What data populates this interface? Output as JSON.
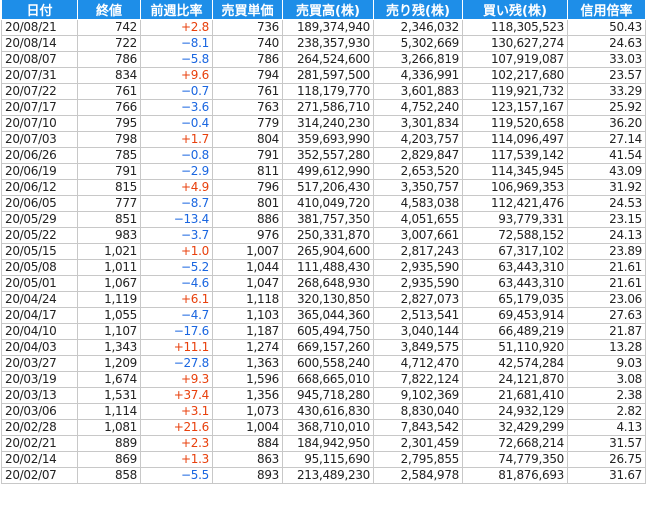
{
  "headers": [
    "日付",
    "終値",
    "前週比率",
    "売買単価",
    "売買高(株)",
    "売り残(株)",
    "買い残(株)",
    "信用倍率"
  ],
  "colors": {
    "header_bg": "#1e8ee8",
    "positive": "#e8400c",
    "negative": "#1a66e0"
  },
  "rows": [
    {
      "date": "20/08/21",
      "close": "742",
      "change": "+2.8",
      "dir": "up",
      "unit_price": "736",
      "volume": "189,374,940",
      "short": "2,346,032",
      "long": "118,305,523",
      "ratio": "50.43"
    },
    {
      "date": "20/08/14",
      "close": "722",
      "change": "−8.1",
      "dir": "down",
      "unit_price": "740",
      "volume": "238,357,930",
      "short": "5,302,669",
      "long": "130,627,274",
      "ratio": "24.63"
    },
    {
      "date": "20/08/07",
      "close": "786",
      "change": "−5.8",
      "dir": "down",
      "unit_price": "786",
      "volume": "264,524,600",
      "short": "3,266,819",
      "long": "107,919,087",
      "ratio": "33.03"
    },
    {
      "date": "20/07/31",
      "close": "834",
      "change": "+9.6",
      "dir": "up",
      "unit_price": "794",
      "volume": "281,597,500",
      "short": "4,336,991",
      "long": "102,217,680",
      "ratio": "23.57"
    },
    {
      "date": "20/07/22",
      "close": "761",
      "change": "−0.7",
      "dir": "down",
      "unit_price": "761",
      "volume": "118,179,770",
      "short": "3,601,883",
      "long": "119,921,732",
      "ratio": "33.29"
    },
    {
      "date": "20/07/17",
      "close": "766",
      "change": "−3.6",
      "dir": "down",
      "unit_price": "763",
      "volume": "271,586,710",
      "short": "4,752,240",
      "long": "123,157,167",
      "ratio": "25.92"
    },
    {
      "date": "20/07/10",
      "close": "795",
      "change": "−0.4",
      "dir": "down",
      "unit_price": "779",
      "volume": "314,240,230",
      "short": "3,301,834",
      "long": "119,520,658",
      "ratio": "36.20"
    },
    {
      "date": "20/07/03",
      "close": "798",
      "change": "+1.7",
      "dir": "up",
      "unit_price": "804",
      "volume": "359,693,990",
      "short": "4,203,757",
      "long": "114,096,497",
      "ratio": "27.14"
    },
    {
      "date": "20/06/26",
      "close": "785",
      "change": "−0.8",
      "dir": "down",
      "unit_price": "791",
      "volume": "352,557,280",
      "short": "2,829,847",
      "long": "117,539,142",
      "ratio": "41.54"
    },
    {
      "date": "20/06/19",
      "close": "791",
      "change": "−2.9",
      "dir": "down",
      "unit_price": "811",
      "volume": "499,612,990",
      "short": "2,653,520",
      "long": "114,345,945",
      "ratio": "43.09"
    },
    {
      "date": "20/06/12",
      "close": "815",
      "change": "+4.9",
      "dir": "up",
      "unit_price": "796",
      "volume": "517,206,430",
      "short": "3,350,757",
      "long": "106,969,353",
      "ratio": "31.92"
    },
    {
      "date": "20/06/05",
      "close": "777",
      "change": "−8.7",
      "dir": "down",
      "unit_price": "801",
      "volume": "410,049,720",
      "short": "4,583,038",
      "long": "112,421,476",
      "ratio": "24.53"
    },
    {
      "date": "20/05/29",
      "close": "851",
      "change": "−13.4",
      "dir": "down",
      "unit_price": "886",
      "volume": "381,757,350",
      "short": "4,051,655",
      "long": "93,779,331",
      "ratio": "23.15"
    },
    {
      "date": "20/05/22",
      "close": "983",
      "change": "−3.7",
      "dir": "down",
      "unit_price": "976",
      "volume": "250,331,870",
      "short": "3,007,661",
      "long": "72,588,152",
      "ratio": "24.13"
    },
    {
      "date": "20/05/15",
      "close": "1,021",
      "change": "+1.0",
      "dir": "up",
      "unit_price": "1,007",
      "volume": "265,904,600",
      "short": "2,817,243",
      "long": "67,317,102",
      "ratio": "23.89"
    },
    {
      "date": "20/05/08",
      "close": "1,011",
      "change": "−5.2",
      "dir": "down",
      "unit_price": "1,044",
      "volume": "111,488,430",
      "short": "2,935,590",
      "long": "63,443,310",
      "ratio": "21.61"
    },
    {
      "date": "20/05/01",
      "close": "1,067",
      "change": "−4.6",
      "dir": "down",
      "unit_price": "1,047",
      "volume": "268,648,930",
      "short": "2,935,590",
      "long": "63,443,310",
      "ratio": "21.61"
    },
    {
      "date": "20/04/24",
      "close": "1,119",
      "change": "+6.1",
      "dir": "up",
      "unit_price": "1,118",
      "volume": "320,130,850",
      "short": "2,827,073",
      "long": "65,179,035",
      "ratio": "23.06"
    },
    {
      "date": "20/04/17",
      "close": "1,055",
      "change": "−4.7",
      "dir": "down",
      "unit_price": "1,103",
      "volume": "365,044,360",
      "short": "2,513,541",
      "long": "69,453,914",
      "ratio": "27.63"
    },
    {
      "date": "20/04/10",
      "close": "1,107",
      "change": "−17.6",
      "dir": "down",
      "unit_price": "1,187",
      "volume": "605,494,750",
      "short": "3,040,144",
      "long": "66,489,219",
      "ratio": "21.87"
    },
    {
      "date": "20/04/03",
      "close": "1,343",
      "change": "+11.1",
      "dir": "up",
      "unit_price": "1,274",
      "volume": "669,157,260",
      "short": "3,849,575",
      "long": "51,110,920",
      "ratio": "13.28"
    },
    {
      "date": "20/03/27",
      "close": "1,209",
      "change": "−27.8",
      "dir": "down",
      "unit_price": "1,363",
      "volume": "600,558,240",
      "short": "4,712,470",
      "long": "42,574,284",
      "ratio": "9.03"
    },
    {
      "date": "20/03/19",
      "close": "1,674",
      "change": "+9.3",
      "dir": "up",
      "unit_price": "1,596",
      "volume": "668,665,010",
      "short": "7,822,124",
      "long": "24,121,870",
      "ratio": "3.08"
    },
    {
      "date": "20/03/13",
      "close": "1,531",
      "change": "+37.4",
      "dir": "up",
      "unit_price": "1,356",
      "volume": "945,718,280",
      "short": "9,102,369",
      "long": "21,681,410",
      "ratio": "2.38"
    },
    {
      "date": "20/03/06",
      "close": "1,114",
      "change": "+3.1",
      "dir": "up",
      "unit_price": "1,073",
      "volume": "430,616,830",
      "short": "8,830,040",
      "long": "24,932,129",
      "ratio": "2.82"
    },
    {
      "date": "20/02/28",
      "close": "1,081",
      "change": "+21.6",
      "dir": "up",
      "unit_price": "1,004",
      "volume": "368,710,010",
      "short": "7,843,542",
      "long": "32,429,299",
      "ratio": "4.13"
    },
    {
      "date": "20/02/21",
      "close": "889",
      "change": "+2.3",
      "dir": "up",
      "unit_price": "884",
      "volume": "184,942,950",
      "short": "2,301,459",
      "long": "72,668,214",
      "ratio": "31.57"
    },
    {
      "date": "20/02/14",
      "close": "869",
      "change": "+1.3",
      "dir": "up",
      "unit_price": "863",
      "volume": "95,115,690",
      "short": "2,795,855",
      "long": "74,779,350",
      "ratio": "26.75"
    },
    {
      "date": "20/02/07",
      "close": "858",
      "change": "−5.5",
      "dir": "down",
      "unit_price": "893",
      "volume": "213,489,230",
      "short": "2,584,978",
      "long": "81,876,693",
      "ratio": "31.67"
    }
  ]
}
